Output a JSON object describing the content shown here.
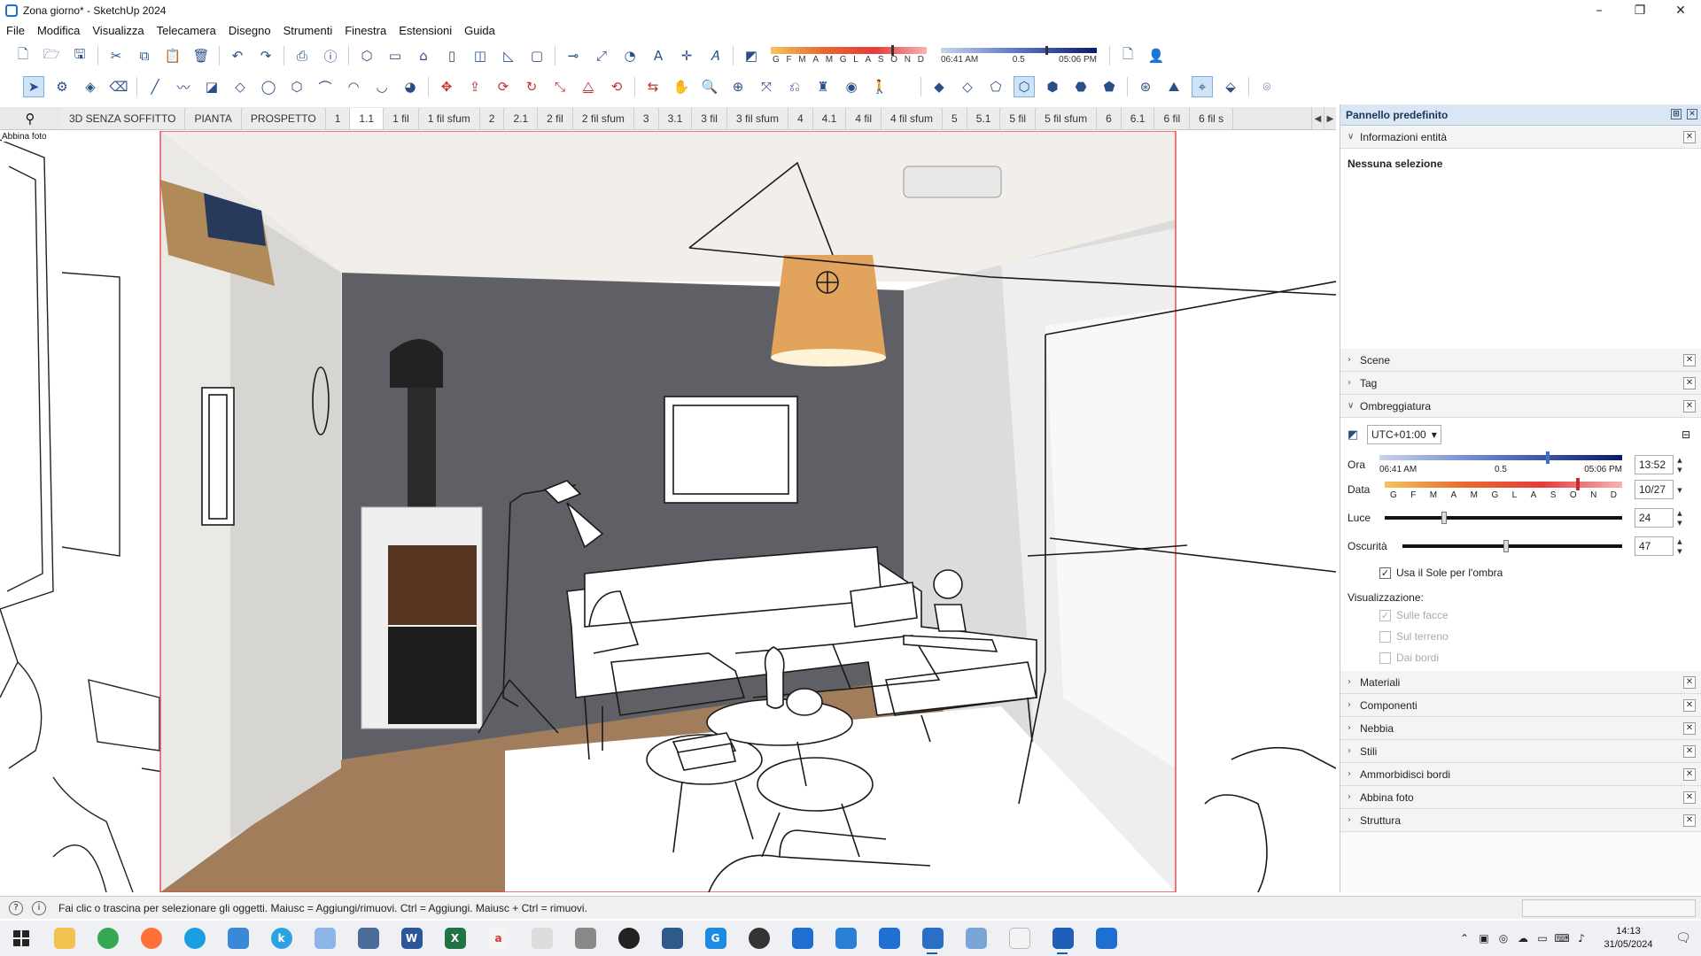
{
  "window": {
    "title": "Zona giorno* - SketchUp 2024"
  },
  "menu": [
    "File",
    "Modifica",
    "Visualizza",
    "Telecamera",
    "Disegno",
    "Strumenti",
    "Finestra",
    "Estensioni",
    "Guida"
  ],
  "toolbar_shadow": {
    "months": [
      "G",
      "F",
      "M",
      "A",
      "M",
      "G",
      "L",
      "A",
      "S",
      "O",
      "N",
      "D"
    ],
    "time_start": "06:41 AM",
    "time_mid": "0.5",
    "time_end": "05:06 PM"
  },
  "scene_tabs": [
    "3D SENZA SOFFITTO",
    "PIANTA",
    "PROSPETTO",
    "1",
    "1.1",
    "1 fil",
    "1 fil sfum",
    "2",
    "2.1",
    "2 fil",
    "2 fil sfum",
    "3",
    "3.1",
    "3 fil",
    "3 fil sfum",
    "4",
    "4.1",
    "4 fil",
    "4 fil sfum",
    "5",
    "5.1",
    "5 fil",
    "5 fil sfum",
    "6",
    "6.1",
    "6 fil",
    "6 fil s"
  ],
  "active_scene_tab": "1.1",
  "viewport": {
    "overlay_label": "Abbina foto"
  },
  "panel": {
    "title": "Pannello predefinito",
    "entity_info": {
      "label": "Informazioni entità",
      "selection": "Nessuna selezione"
    },
    "sections_top": [
      "Scene",
      "Tag"
    ],
    "shading": {
      "label": "Ombreggiatura",
      "timezone": "UTC+01:00",
      "time_label": "Ora",
      "time_start": "06:41 AM",
      "time_mid": "0.5",
      "time_end": "05:06 PM",
      "time_value": "13:52",
      "date_label": "Data",
      "date_value": "10/27",
      "months": [
        "G",
        "F",
        "M",
        "A",
        "M",
        "G",
        "L",
        "A",
        "S",
        "O",
        "N",
        "D"
      ],
      "light_label": "Luce",
      "light_value": "24",
      "dark_label": "Oscurità",
      "dark_value": "47",
      "use_sun_label": "Usa il Sole per l'ombra",
      "display_label": "Visualizzazione:",
      "on_faces": "Sulle facce",
      "on_ground": "Sul terreno",
      "from_edges": "Dai bordi"
    },
    "sections_bottom": [
      "Materiali",
      "Componenti",
      "Nebbia",
      "Stili",
      "Ammorbidisci bordi",
      "Abbina foto",
      "Struttura"
    ]
  },
  "status": {
    "message": "Fai clic o trascina per selezionare gli oggetti. Maiusc = Aggiungi/rimuovi. Ctrl = Aggiungi. Maiusc + Ctrl = rimuovi."
  },
  "taskbar": {
    "time": "14:13",
    "date": "31/05/2024"
  },
  "colors": {
    "accent": "#1f6fd0",
    "panel_header": "#d9e6f4",
    "wall": "#5f6166",
    "selection_border": "#e05050"
  }
}
